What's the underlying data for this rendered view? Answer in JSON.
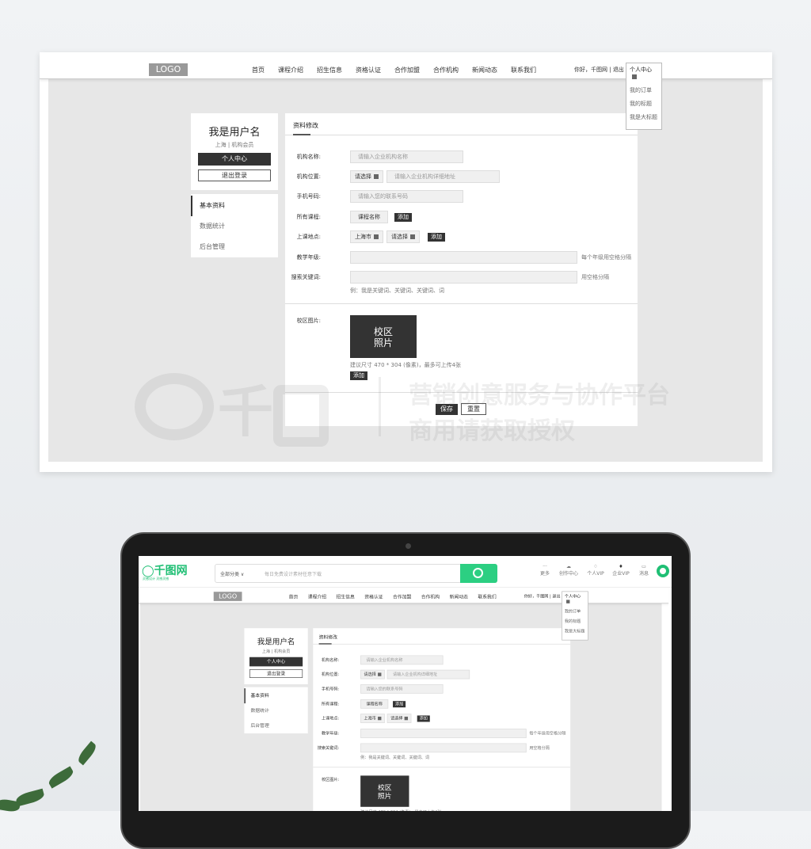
{
  "header": {
    "logo": "LOGO",
    "nav": [
      "首页",
      "课程介绍",
      "招生信息",
      "资格认证",
      "合作加盟",
      "合作机构",
      "新闻动态",
      "联系我们"
    ],
    "greeting": "你好，千图网",
    "logout": "退出",
    "user_center": "个人中心",
    "dropdown": [
      "我的订单",
      "我的标题",
      "我是大标题"
    ]
  },
  "profile": {
    "name": "我是用户名",
    "sub": "上海 | 机构会员",
    "center_btn": "个人中心",
    "logout_btn": "退出登录"
  },
  "menu": [
    "基本资料",
    "数据统计",
    "后台管理"
  ],
  "form": {
    "tab": "资料修改",
    "org_name": {
      "label": "机构名称:",
      "placeholder": "请输入企业机构名称"
    },
    "org_loc": {
      "label": "机构位置:",
      "select": "请选择",
      "placeholder": "请输入企业机构详细地址"
    },
    "phone": {
      "label": "手机号码:",
      "placeholder": "请输入您的联系号码"
    },
    "courses": {
      "label": "所有课程:",
      "value": "课程名称",
      "add": "添加"
    },
    "place": {
      "label": "上课地点:",
      "city": "上海市",
      "select": "请选择",
      "add": "添加"
    },
    "grade": {
      "label": "教学年级:",
      "hint": "每个年级用空格分隔"
    },
    "keywords": {
      "label": "搜索关键词:",
      "hint": "用空格分隔",
      "example": "例：我是关键词、关键词、关键词、词"
    },
    "photo": {
      "label": "校区图片:",
      "placeholder_l1": "校区",
      "placeholder_l2": "照片",
      "hint": "建议尺寸 470 * 304 (像素)，最多可上传4张",
      "add": "添加"
    },
    "save": "保存",
    "reset": "重置"
  },
  "watermark": {
    "logo": "千图",
    "line1": "营销创意服务与协作平台",
    "line2": "商用请获取授权"
  },
  "site_bar": {
    "logo": "千图网",
    "slogan": "灵感设计  灵感灵感",
    "category": "全部分类 ∨",
    "search_placeholder": "每日免费设计素材任意下载",
    "icons": [
      {
        "icon": "more-icon",
        "label": "更多"
      },
      {
        "icon": "upload-icon",
        "label": "创作中心"
      },
      {
        "icon": "diamond-icon",
        "label": "个人VIP"
      },
      {
        "icon": "diamond-icon",
        "label": "企业VIP"
      },
      {
        "icon": "message-icon",
        "label": "消息"
      }
    ],
    "accent": "#2ccf82"
  }
}
